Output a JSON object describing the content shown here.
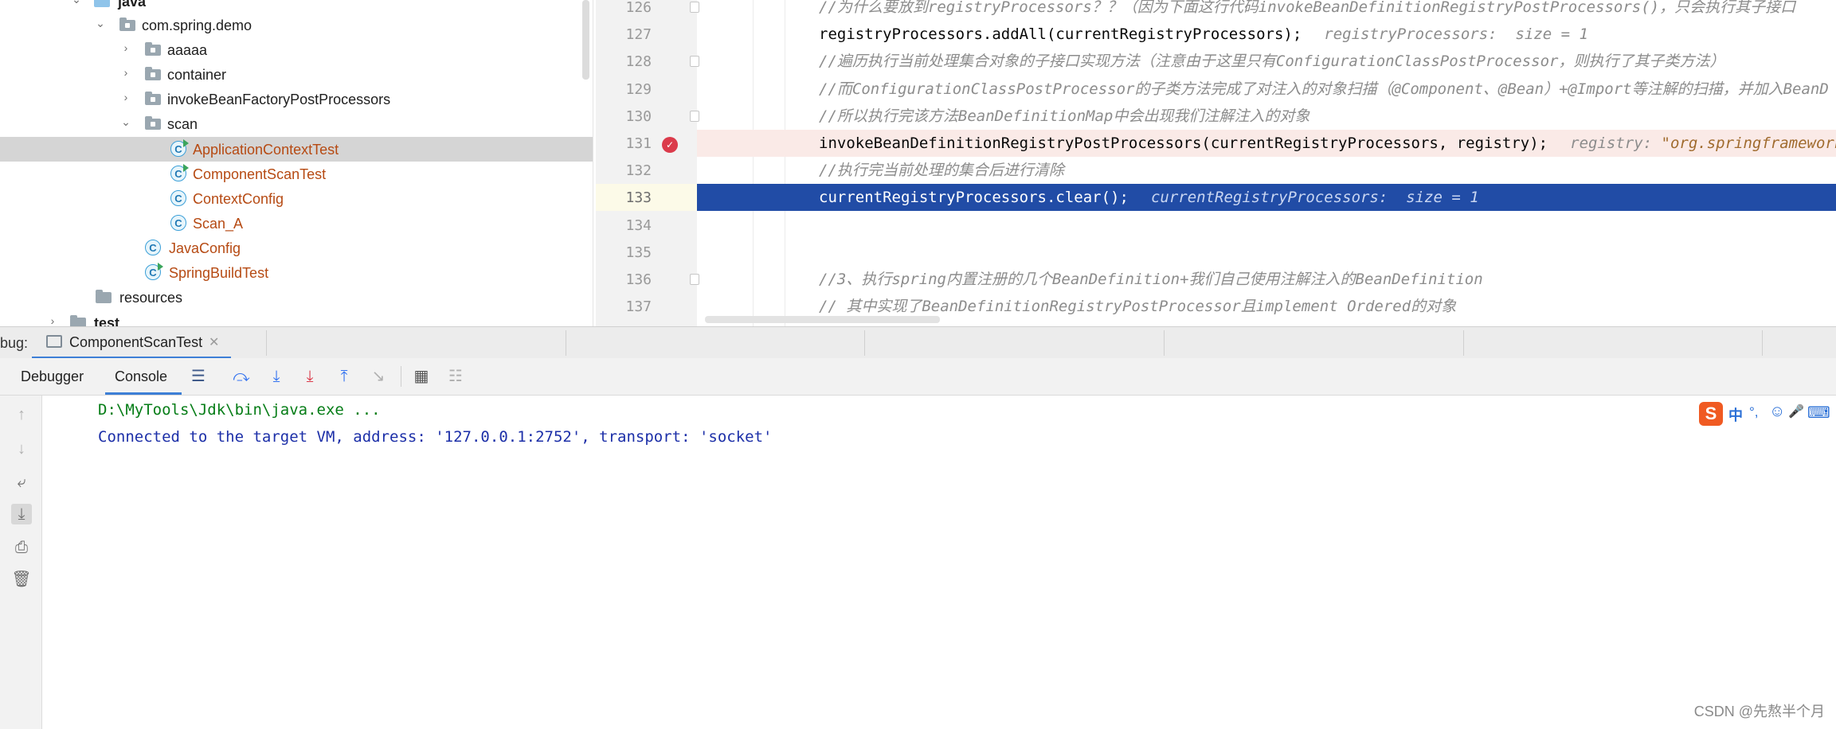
{
  "project_tree": {
    "items": [
      {
        "label": "java",
        "type": "source-folder"
      },
      {
        "label": "com.spring.demo",
        "type": "package"
      },
      {
        "label": "aaaaa",
        "type": "package"
      },
      {
        "label": "container",
        "type": "package"
      },
      {
        "label": "invokeBeanFactoryPostProcessors",
        "type": "package"
      },
      {
        "label": "scan",
        "type": "package"
      },
      {
        "label": "ApplicationContextTest",
        "type": "test-class",
        "selected": true
      },
      {
        "label": "ComponentScanTest",
        "type": "test-class"
      },
      {
        "label": "ContextConfig",
        "type": "class"
      },
      {
        "label": "Scan_A",
        "type": "class"
      },
      {
        "label": "JavaConfig",
        "type": "class"
      },
      {
        "label": "SpringBuildTest",
        "type": "test-class"
      },
      {
        "label": "resources",
        "type": "resources-folder"
      },
      {
        "label": "test",
        "type": "folder"
      }
    ],
    "class_icon_letter": "C"
  },
  "editor": {
    "lines": [
      {
        "number": "126",
        "text": "//为什么要放到registryProcessors？？（因为下面这行代码invokeBeanDefinitionRegistryPostProcessors()，只会执行其子接口",
        "kind": "comment"
      },
      {
        "number": "127",
        "text": "registryProcessors.addAll(currentRegistryProcessors);",
        "kind": "code",
        "hint": "registryProcessors:  size = 1"
      },
      {
        "number": "128",
        "text": "//遍历执行当前处理集合对象的子接口实现方法（注意由于这里只有ConfigurationClassPostProcessor，则执行了其子类方法）",
        "kind": "comment"
      },
      {
        "number": "129",
        "text": "//而ConfigurationClassPostProcessor的子类方法完成了对注入的对象扫描（@Component、@Bean）+@Import等注解的扫描，并加入BeanD",
        "kind": "comment"
      },
      {
        "number": "130",
        "text": "//所以执行完该方法BeanDefinitionMap中会出现我们注解注入的对象",
        "kind": "comment"
      },
      {
        "number": "131",
        "text": "invokeBeanDefinitionRegistryPostProcessors(currentRegistryProcessors, registry);",
        "kind": "code",
        "hint_prefix": "registry: ",
        "hint_value": "\"org.springframework"
      },
      {
        "number": "132",
        "text": "//执行完当前处理的集合后进行清除",
        "kind": "comment"
      },
      {
        "number": "133",
        "text": "currentRegistryProcessors.clear();",
        "kind": "code",
        "hint": "currentRegistryProcessors:  size = 1"
      },
      {
        "number": "134",
        "text": "",
        "kind": "blank"
      },
      {
        "number": "135",
        "text": "",
        "kind": "blank"
      },
      {
        "number": "136",
        "text": "//3、执行spring内置注册的几个BeanDefinition+我们自己使用注解注入的BeanDefinition",
        "kind": "comment"
      },
      {
        "number": "137",
        "text": "// 其中实现了BeanDefinitionRegistryPostProcessor且implement Ordered的对象",
        "kind": "comment"
      }
    ],
    "breakpoint_line": "131",
    "execution_line": "133"
  },
  "debug": {
    "label": "bug:",
    "session_tab": "ComponentScanTest",
    "tabs": [
      "Debugger",
      "Console"
    ],
    "active_tab": "Console",
    "toolbar_icons": [
      "menu-icon",
      "step-over-icon",
      "step-into-icon",
      "force-step-into-icon",
      "step-out-icon",
      "run-to-cursor-icon",
      "evaluate-expression-icon",
      "trace-icon"
    ],
    "side_icons": [
      "up-arrow-icon",
      "down-arrow-icon",
      "soft-wrap-icon",
      "scroll-to-end-icon",
      "print-icon",
      "trash-icon"
    ]
  },
  "console": {
    "lines": [
      {
        "text": "D:\\MyTools\\Jdk\\bin\\java.exe ...",
        "color": "#067d17"
      },
      {
        "text": "Connected to the target VM, address: '127.0.0.1:2752', transport: 'socket'",
        "color": "#1c2fa8"
      }
    ]
  },
  "ime_bar": {
    "logo": "S",
    "items": [
      "中",
      "°,",
      "☺",
      "🎤",
      "⌨"
    ]
  },
  "watermark": "CSDN @先熬半个月",
  "colors": {
    "selection_bg": "#214ca6",
    "breakpoint_line_bg": "#faeae7",
    "breakpoint": "#db3b4b",
    "tree_selected_bg": "#d5d5d5",
    "console_path": "#067d17",
    "console_text": "#1c2fa8"
  }
}
